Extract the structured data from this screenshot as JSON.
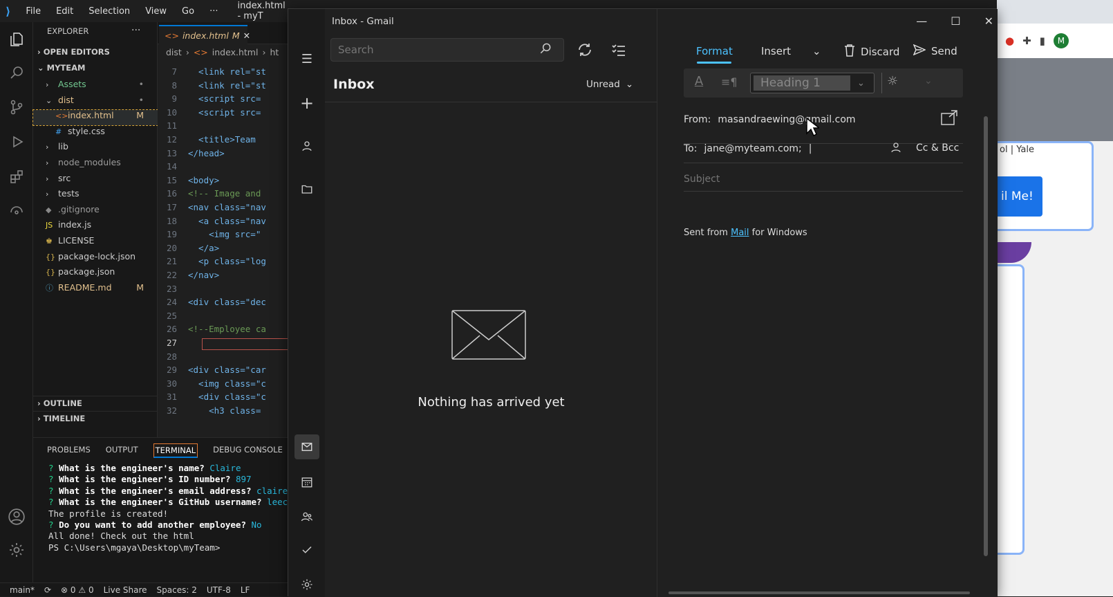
{
  "vscode": {
    "menus": [
      "File",
      "Edit",
      "Selection",
      "View",
      "Go",
      "···"
    ],
    "window_title": "index.html - myT",
    "explorer_title": "EXPLORER",
    "explorer_more": "···",
    "open_editors": "OPEN EDITORS",
    "project": "MYTEAM",
    "tree": [
      {
        "label": "Assets",
        "badge": "•",
        "indent": 1,
        "type": "folder",
        "color": "#73c991"
      },
      {
        "label": "dist",
        "badge": "•",
        "indent": 1,
        "type": "folder-open",
        "color": "#e2c08d"
      },
      {
        "label": "index.html",
        "badge": "M",
        "indent": 2,
        "type": "html",
        "color": "#e2c08d"
      },
      {
        "label": "style.css",
        "badge": "",
        "indent": 2,
        "type": "css",
        "color": "#ccc"
      },
      {
        "label": "lib",
        "badge": "",
        "indent": 1,
        "type": "folder",
        "color": "#ccc"
      },
      {
        "label": "node_modules",
        "badge": "",
        "indent": 1,
        "type": "folder",
        "color": "#9d9d9d"
      },
      {
        "label": "src",
        "badge": "",
        "indent": 1,
        "type": "folder",
        "color": "#ccc"
      },
      {
        "label": "tests",
        "badge": "",
        "indent": 1,
        "type": "folder",
        "color": "#ccc"
      },
      {
        "label": ".gitignore",
        "badge": "",
        "indent": 1,
        "type": "git",
        "color": "#9d9d9d"
      },
      {
        "label": "index.js",
        "badge": "",
        "indent": 1,
        "type": "js",
        "color": "#ccc"
      },
      {
        "label": "LICENSE",
        "badge": "",
        "indent": 1,
        "type": "license",
        "color": "#ccc"
      },
      {
        "label": "package-lock.json",
        "badge": "",
        "indent": 1,
        "type": "json",
        "color": "#ccc"
      },
      {
        "label": "package.json",
        "badge": "",
        "indent": 1,
        "type": "json",
        "color": "#ccc"
      },
      {
        "label": "README.md",
        "badge": "M",
        "indent": 1,
        "type": "md",
        "color": "#e2c08d"
      }
    ],
    "outline": "OUTLINE",
    "timeline": "TIMELINE",
    "tab_label": "index.html",
    "tab_badge": "M",
    "breadcrumb": [
      "dist",
      "index.html",
      "ht"
    ],
    "code": [
      {
        "n": "7",
        "t": "  <link rel=\"st"
      },
      {
        "n": "8",
        "t": "  <link rel=\"st"
      },
      {
        "n": "9",
        "t": "  <script src="
      },
      {
        "n": "10",
        "t": "  <script src="
      },
      {
        "n": "11",
        "t": ""
      },
      {
        "n": "12",
        "t": "  <title>Team "
      },
      {
        "n": "13",
        "t": "</head>"
      },
      {
        "n": "14",
        "t": ""
      },
      {
        "n": "15",
        "t": "<body>"
      },
      {
        "n": "16",
        "t": "<!-- Image and"
      },
      {
        "n": "17",
        "t": "<nav class=\"nav"
      },
      {
        "n": "18",
        "t": "  <a class=\"nav"
      },
      {
        "n": "19",
        "t": "    <img src=\""
      },
      {
        "n": "20",
        "t": "  </a>"
      },
      {
        "n": "21",
        "t": "  <p class=\"log"
      },
      {
        "n": "22",
        "t": "</nav>"
      },
      {
        "n": "23",
        "t": ""
      },
      {
        "n": "24",
        "t": "<div class=\"dec"
      },
      {
        "n": "25",
        "t": ""
      },
      {
        "n": "26",
        "t": "<!--Employee ca"
      },
      {
        "n": "27",
        "t": ""
      },
      {
        "n": "28",
        "t": ""
      },
      {
        "n": "29",
        "t": "<div class=\"car"
      },
      {
        "n": "30",
        "t": "  <img class=\"c"
      },
      {
        "n": "31",
        "t": "  <div class=\"c"
      },
      {
        "n": "32",
        "t": "    <h3 class="
      }
    ],
    "panel_tabs": [
      "PROBLEMS",
      "OUTPUT",
      "TERMINAL",
      "DEBUG CONSOLE"
    ],
    "terminal": [
      {
        "q": "? ",
        "b": "What is the engineer's name? ",
        "a": "Claire"
      },
      {
        "q": "? ",
        "b": "What is the engineer's ID number? ",
        "a": "897"
      },
      {
        "q": "? ",
        "b": "What is the engineer's email address? ",
        "a": "claire"
      },
      {
        "q": "? ",
        "b": "What is the engineer's GitHub username? ",
        "a": "leec"
      },
      {
        "q": "",
        "b": "",
        "a": "The profile is created!"
      },
      {
        "q": "? ",
        "b": "Do you want to add another employee? ",
        "a": "No"
      },
      {
        "q": "",
        "b": "",
        "a": "All done! Check out the html"
      },
      {
        "q": "",
        "b": "",
        "a": "PS C:\\Users\\mgaya\\Desktop\\myTeam> "
      }
    ],
    "status": [
      "main*",
      "⟳",
      "⊗ 0 ⚠ 0",
      "Live Share",
      "Spaces: 2",
      "UTF-8",
      "LF"
    ]
  },
  "mail": {
    "window_title": "Inbox - Gmail",
    "search_placeholder": "Search",
    "folder_title": "Inbox",
    "filter": "Unread",
    "empty_text": "Nothing has arrived yet",
    "compose": {
      "tabs": [
        "Format",
        "Insert"
      ],
      "discard": "Discard",
      "send": "Send",
      "style_value": "Heading 1",
      "from_label": "From:",
      "from_value": "masandraewing@gmail.com",
      "to_label": "To:",
      "to_value": "jane@myteam.com;",
      "cc_bcc": "Cc & Bcc",
      "subject_placeholder": "Subject",
      "signature_prefix": "Sent from ",
      "signature_link": "Mail",
      "signature_suffix": " for Windows"
    }
  },
  "chrome": {
    "avatar_letter": "M",
    "page_text": "ol | Yale",
    "button_text": "il Me!"
  },
  "colors": {
    "accent": "#4cc2ff",
    "vscode_blue": "#0078d4",
    "chrome_button": "#1a73e8"
  }
}
